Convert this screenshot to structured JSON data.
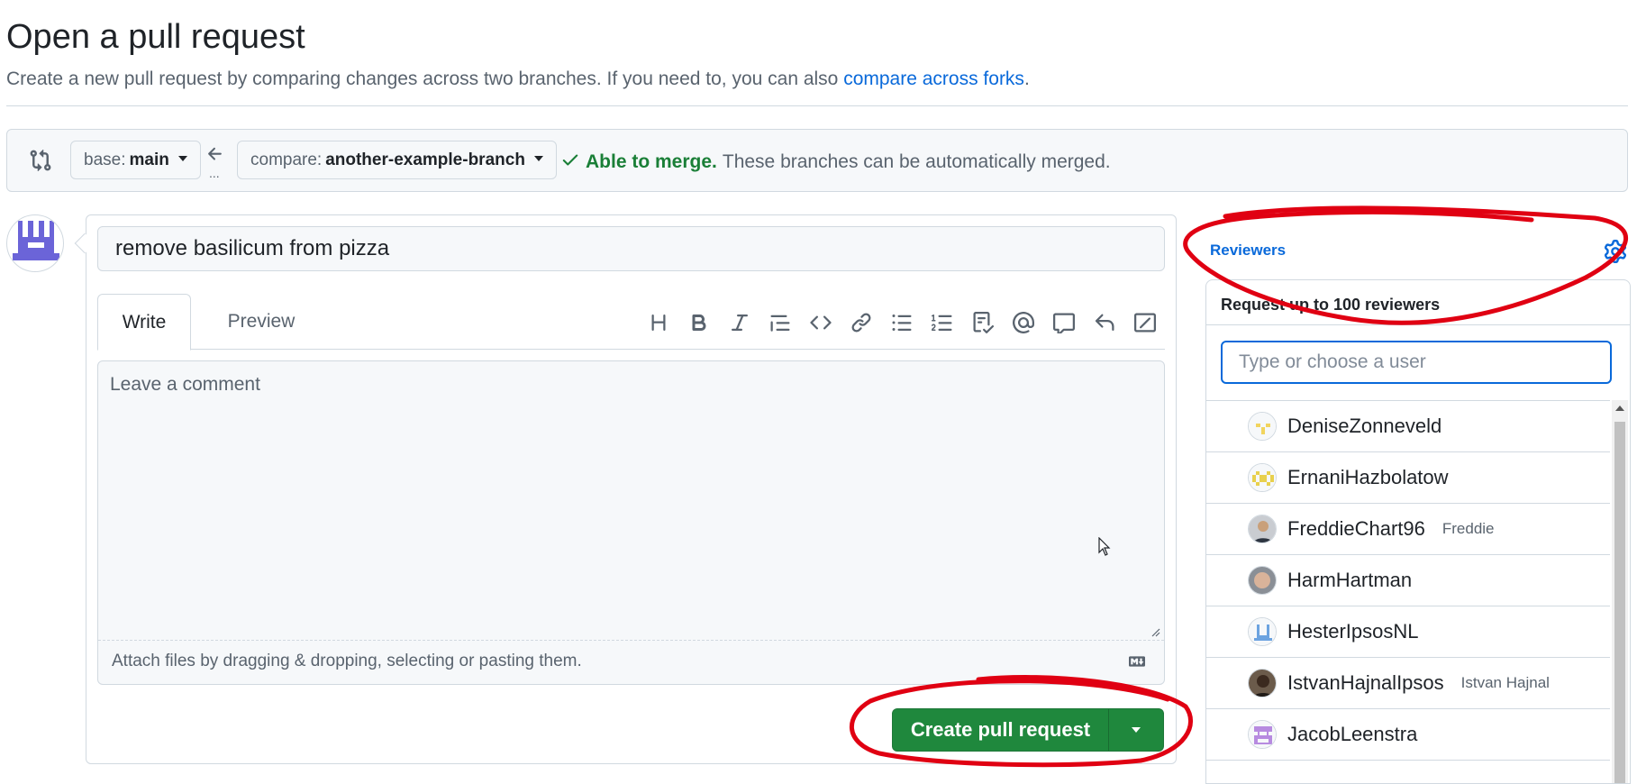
{
  "page": {
    "title": "Open a pull request",
    "subtitle_prefix": "Create a new pull request by comparing changes across two branches. If you need to, you can also ",
    "subtitle_link": "compare across forks",
    "subtitle_suffix": "."
  },
  "compare": {
    "base_label": "base:",
    "base_value": "main",
    "arrow_dots": "...",
    "compare_label": "compare:",
    "compare_value": "another-example-branch",
    "merge_ok": "Able to merge.",
    "merge_text": "These branches can be automatically merged."
  },
  "form": {
    "title_value": "remove basilicum from pizza",
    "tab_write": "Write",
    "tab_preview": "Preview",
    "comment_placeholder": "Leave a comment",
    "attach_text": "Attach files by dragging & dropping, selecting or pasting them.",
    "create_label": "Create pull request"
  },
  "toolbar": [
    "heading-icon",
    "bold-icon",
    "italic-icon",
    "quote-icon",
    "code-icon",
    "link-icon",
    "unordered-list-icon",
    "ordered-list-icon",
    "task-list-icon",
    "mention-icon",
    "reference-icon",
    "reply-icon",
    "slash-command-icon"
  ],
  "reviewers": {
    "label": "Reviewers",
    "header": "Request up to 100 reviewers",
    "search_placeholder": "Type or choose a user",
    "users": [
      {
        "login": "DeniseZonneveld",
        "name": ""
      },
      {
        "login": "ErnaniHazbolatow",
        "name": ""
      },
      {
        "login": "FreddieChart96",
        "name": "Freddie"
      },
      {
        "login": "HarmHartman",
        "name": ""
      },
      {
        "login": "HesterIpsosNL",
        "name": ""
      },
      {
        "login": "IstvanHajnalIpsos",
        "name": "Istvan Hajnal"
      },
      {
        "login": "JacobLeenstra",
        "name": ""
      }
    ]
  },
  "colors": {
    "accent": "#0969da",
    "success": "#1f883d",
    "annotation": "#e00012"
  }
}
